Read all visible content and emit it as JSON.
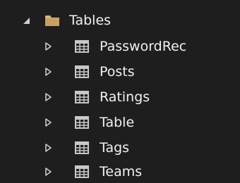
{
  "tree": {
    "root": {
      "label": "Tables",
      "expanded": true,
      "icon": "folder-icon",
      "toggle_icon": "expanded-triangle-icon"
    },
    "children": [
      {
        "label": "PasswordRec",
        "icon": "table-icon",
        "toggle_icon": "collapsed-triangle-icon"
      },
      {
        "label": "Posts",
        "icon": "table-icon",
        "toggle_icon": "collapsed-triangle-icon"
      },
      {
        "label": "Ratings",
        "icon": "table-icon",
        "toggle_icon": "collapsed-triangle-icon"
      },
      {
        "label": "Table",
        "icon": "table-icon",
        "toggle_icon": "collapsed-triangle-icon"
      },
      {
        "label": "Tags",
        "icon": "table-icon",
        "toggle_icon": "collapsed-triangle-icon"
      },
      {
        "label": "Teams",
        "icon": "table-icon",
        "toggle_icon": "collapsed-triangle-icon"
      }
    ]
  },
  "colors": {
    "background": "#1e1e1e",
    "text": "#f1f1f1",
    "folder": "#dcb67a",
    "table_icon": "#c8c8c8",
    "toggle": "#d0d0d0"
  }
}
